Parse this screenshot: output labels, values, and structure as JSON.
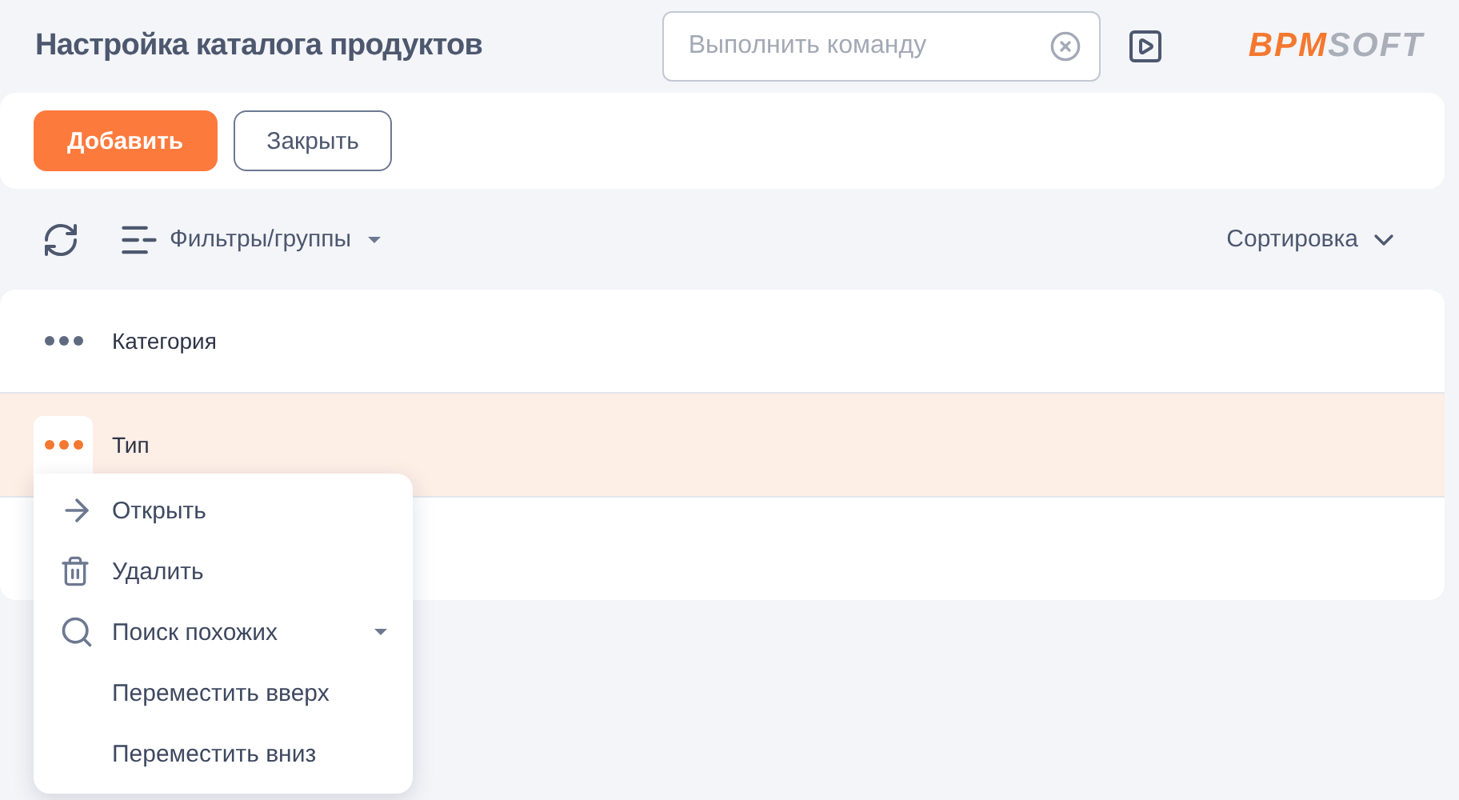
{
  "header": {
    "title": "Настройка каталога продуктов",
    "command_search": {
      "placeholder": "Выполнить команду"
    },
    "logo": {
      "accent": "BPM",
      "rest": "SOFT"
    }
  },
  "actions": [
    {
      "label": "Добавить",
      "kind": "primary"
    },
    {
      "label": "Закрыть",
      "kind": "outline"
    }
  ],
  "toolbar": {
    "filter_label": "Фильтры/группы",
    "sort_label": "Сортировка"
  },
  "rows": [
    {
      "label": "Категория",
      "selected": false
    },
    {
      "label": "Тип",
      "selected": true,
      "menu": [
        {
          "label": "Открыть",
          "kind": "arrow",
          "submenu": false
        },
        {
          "label": "Удалить",
          "kind": "trash",
          "submenu": false
        },
        {
          "label": "Поиск похожих",
          "kind": "search",
          "submenu": true
        },
        {
          "label": "Переместить вверх",
          "kind": "plain",
          "submenu": false
        },
        {
          "label": "Переместить вниз",
          "kind": "plain",
          "submenu": false
        }
      ]
    }
  ]
}
